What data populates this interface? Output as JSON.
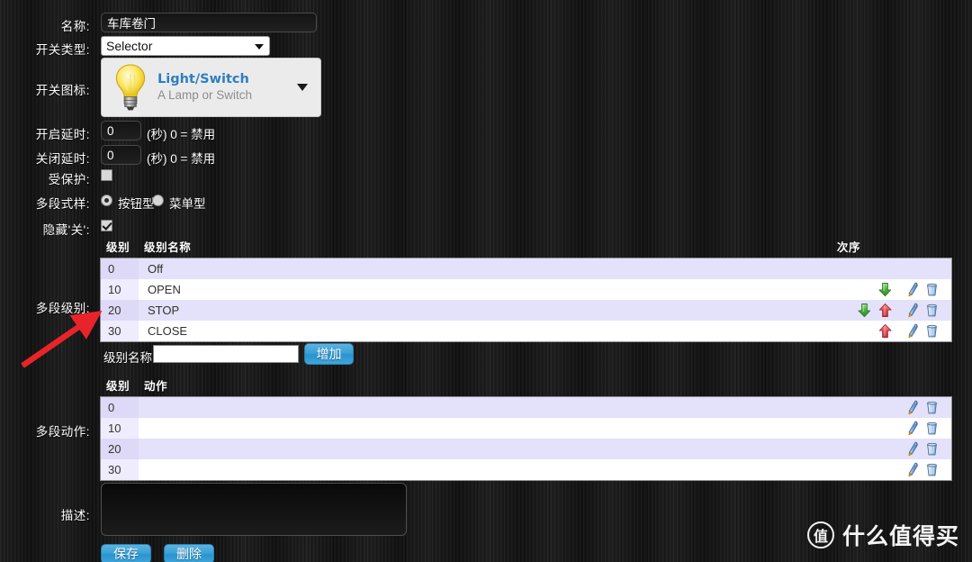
{
  "form": {
    "name": {
      "label": "名称:",
      "value": "车库卷门"
    },
    "switch_type": {
      "label": "开关类型:",
      "value": "Selector"
    },
    "switch_icon": {
      "label": "开关图标:",
      "icon": "lightbulb-icon",
      "title": "Light/Switch",
      "subtitle": "A Lamp or Switch"
    },
    "on_delay": {
      "label": "开启延时:",
      "value": "0",
      "suffix": "(秒) 0 = 禁用"
    },
    "off_delay": {
      "label": "关闭延时:",
      "value": "0",
      "suffix": "(秒) 0 = 禁用"
    },
    "protected": {
      "label": "受保护:",
      "checked": false
    },
    "selector_style": {
      "label": "多段式样:",
      "options": [
        {
          "label": "按钮型",
          "selected": true
        },
        {
          "label": "菜单型",
          "selected": false
        }
      ]
    },
    "hide_off": {
      "label": "隐藏'关':",
      "checked": true
    },
    "levels": {
      "label": "多段级别:"
    },
    "actions": {
      "label": "多段动作:"
    },
    "description": {
      "label": "描述:",
      "value": ""
    }
  },
  "levels_table": {
    "headers": {
      "level": "级别",
      "name": "级别名称",
      "order": "次序"
    },
    "rows": [
      {
        "level": "0",
        "name": "Off",
        "down": false,
        "up": false,
        "edit": false,
        "delete": false
      },
      {
        "level": "10",
        "name": "OPEN",
        "down": true,
        "up": false,
        "edit": true,
        "delete": true
      },
      {
        "level": "20",
        "name": "STOP",
        "down": true,
        "up": true,
        "edit": true,
        "delete": true
      },
      {
        "level": "30",
        "name": "CLOSE",
        "down": false,
        "up": true,
        "edit": true,
        "delete": true
      }
    ]
  },
  "add_level": {
    "label": "级别名称:",
    "value": "",
    "button": "增加"
  },
  "actions_table": {
    "headers": {
      "level": "级别",
      "action": "动作"
    },
    "rows": [
      {
        "level": "0",
        "action": "",
        "edit": true,
        "delete": true
      },
      {
        "level": "10",
        "action": "",
        "edit": true,
        "delete": true
      },
      {
        "level": "20",
        "action": "",
        "edit": true,
        "delete": true
      },
      {
        "level": "30",
        "action": "",
        "edit": true,
        "delete": true
      }
    ]
  },
  "buttons": {
    "save": "保存",
    "delete": "删除"
  },
  "watermark": {
    "badge": "值",
    "text": "什么值得买"
  },
  "colors": {
    "accent_blue": "#2d7fc1",
    "button_blue": "#3ba1d8",
    "row_odd": "#e3e2fa",
    "level_cell": "#ded9f7",
    "annotation_red": "#e8242a",
    "arrow_green": "#3faa3f",
    "arrow_red": "#e2575f"
  }
}
